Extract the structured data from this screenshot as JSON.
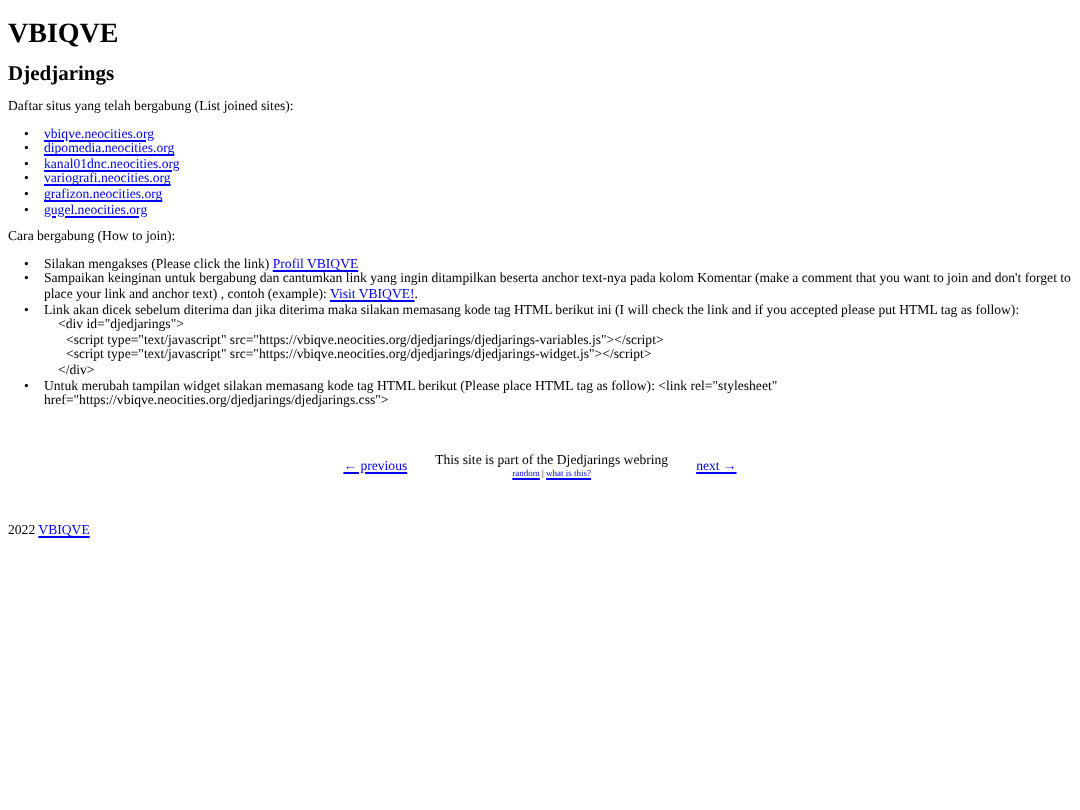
{
  "site_title": "VBIQVE",
  "heading": "Djedjarings",
  "intro": "Daftar situs yang telah bergabung (List joined sites):",
  "sites": [
    {
      "bullet": "•",
      "text": "vbiqve.neocities.org"
    },
    {
      "bullet": "•",
      "text": "dipomedia.neocities.org"
    },
    {
      "bullet": "•",
      "text": "kanal01dnc.neocities.org"
    },
    {
      "bullet": "•",
      "text": "variografi.neocities.org"
    },
    {
      "bullet": "•",
      "text": "grafizon.neocities.org"
    },
    {
      "bullet": "•",
      "text": "gugel.neocities.org"
    }
  ],
  "how_to": "Cara bergabung (How to join):",
  "steps": [
    {
      "bullet": "•",
      "text": "Silakan mengakses (Please click the link) ",
      "link": "Profil VBIQVE"
    },
    {
      "bullet": "•",
      "text": "Sampaikan keinginan untuk bergabung dan cantumkan link yang ingin ditampilkan beserta anchor text-nya pada kolom Komentar (make a comment that you want to join and don't forget to place your link and anchor text) , contoh (example): ",
      "link": "Visit VBIQVE!",
      "after": "."
    },
    {
      "bullet": "•",
      "text": "Link akan dicek sebelum diterima dan jika diterima maka silakan memasang kode tag HTML berikut ini (I will check the link and if you accepted please put HTML tag as follow):",
      "code": [
        {
          "text": "<div id=\"djedjarings\">",
          "children": [
            {
              "text": "<script type=\"text/javascript\" src=\"https://vbiqve.neocities.org/djedjarings/djedjarings-variables.js\"></script>"
            },
            {
              "text": "<script type=\"text/javascript\" src=\"https://vbiqve.neocities.org/djedjarings/djedjarings-widget.js\"></script>"
            }
          ]
        },
        {
          "text": "</div>"
        }
      ]
    },
    {
      "bullet": "•",
      "text": "Untuk merubah tampilan widget silakan memasang kode tag HTML berikut (Please place HTML tag as follow): <link rel=\"stylesheet\" href=\"https://vbiqve.neocities.org/djedjarings/djedjarings.css\">"
    }
  ],
  "webring": {
    "previous": "← previous",
    "text": "This site is part of the Djedjarings webring",
    "random": "random",
    "separator": "|",
    "what": "what is this?",
    "next": "next →"
  },
  "footer": {
    "year": "2022",
    "link": "VBIQVE"
  }
}
